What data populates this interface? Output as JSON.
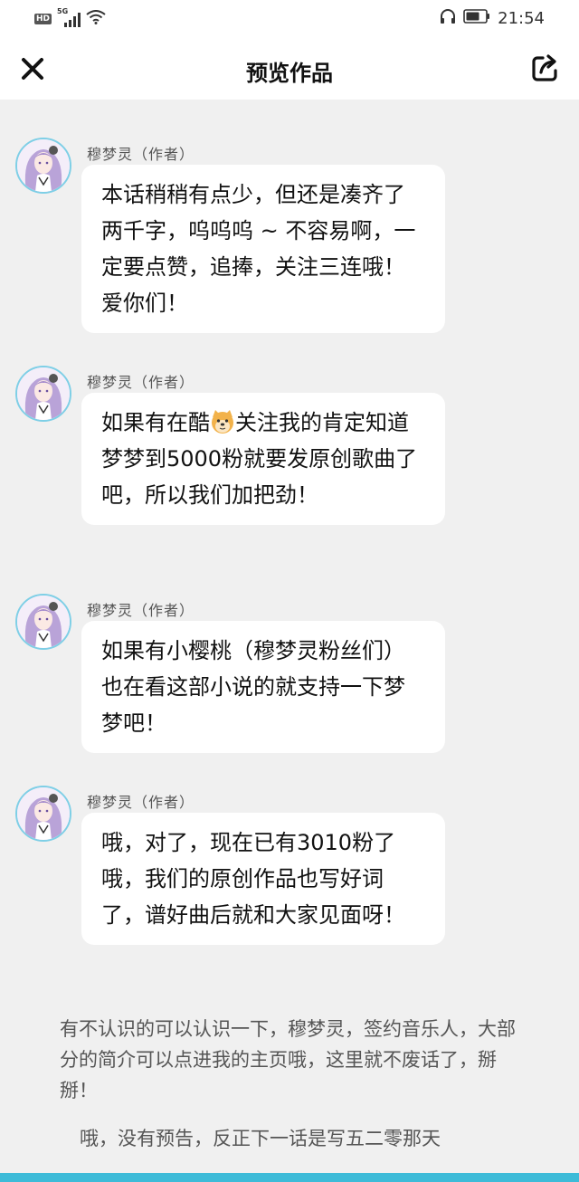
{
  "status_bar": {
    "hd": "HD",
    "network": "5G",
    "time": "21:54"
  },
  "header": {
    "title": "预览作品",
    "close_icon": "close-icon",
    "share_icon": "share-icon"
  },
  "messages": [
    {
      "author": "穆梦灵（作者）",
      "text": "本话稍稍有点少，但还是凑齐了两千字，呜呜呜 ~ 不容易啊，一定要点赞，追捧，关注三连哦！爱你们！"
    },
    {
      "author": "穆梦灵（作者）",
      "text_before": "如果有在酷",
      "emoji": "doge-emoji",
      "text_after": "关注我的肯定知道梦梦到5000粉就要发原创歌曲了吧，所以我们加把劲！"
    },
    {
      "author": "穆梦灵（作者）",
      "text": "如果有小樱桃（穆梦灵粉丝们）也在看这部小说的就支持一下梦梦吧！"
    },
    {
      "author": "穆梦灵（作者）",
      "text": "哦，对了，现在已有3010粉了哦，我们的原创作品也写好词了，谱好曲后就和大家见面呀！"
    }
  ],
  "paragraphs": [
    "有不认识的可以认识一下，穆梦灵，签约音乐人，大部分的简介可以点进我的主页哦，这里就不废话了，掰掰！",
    "哦，没有预告，反正下一话是写五二零那天"
  ],
  "colors": {
    "accent": "#3dbbd8",
    "background": "#f0f0f0",
    "bubble": "#ffffff"
  }
}
